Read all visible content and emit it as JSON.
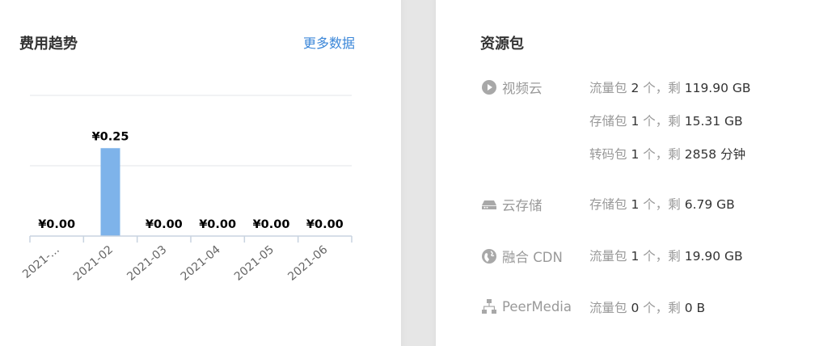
{
  "cost_trend": {
    "title": "费用趋势",
    "more_link": "更多数据"
  },
  "chart_data": {
    "type": "bar",
    "title": "",
    "categories": [
      "2021-...",
      "2021-02",
      "2021-03",
      "2021-04",
      "2021-05",
      "2021-06"
    ],
    "values": [
      0.0,
      0.25,
      0.0,
      0.0,
      0.0,
      0.0
    ],
    "data_labels": [
      "¥0.00",
      "¥0.25",
      "¥0.00",
      "¥0.00",
      "¥0.00",
      "¥0.00"
    ],
    "ylim": [
      0,
      0.4
    ],
    "gridlines": [
      0.2,
      0.4
    ],
    "grid": true,
    "bar_color": "#7eb3ea",
    "xlabel": "",
    "ylabel": ""
  },
  "resources": {
    "title": "资源包",
    "categories": [
      {
        "name": "视频云",
        "icon": "play-circle-icon",
        "lines": [
          {
            "label": "流量包",
            "count": "2",
            "unit": "个，剩",
            "remaining": "119.90 GB"
          },
          {
            "label": "存储包",
            "count": "1",
            "unit": "个，剩",
            "remaining": "15.31 GB"
          },
          {
            "label": "转码包",
            "count": "1",
            "unit": "个，剩",
            "remaining": "2858 分钟"
          }
        ]
      },
      {
        "name": "云存储",
        "icon": "hard-drive-icon",
        "lines": [
          {
            "label": "存储包",
            "count": "1",
            "unit": "个，剩",
            "remaining": "6.79 GB"
          }
        ]
      },
      {
        "name": "融合 CDN",
        "icon": "globe-icon",
        "lines": [
          {
            "label": "流量包",
            "count": "1",
            "unit": "个，剩",
            "remaining": "19.90 GB"
          }
        ]
      },
      {
        "name": "PeerMedia",
        "icon": "network-icon",
        "lines": [
          {
            "label": "流量包",
            "count": "0",
            "unit": "个，剩",
            "remaining": "0 B"
          }
        ]
      }
    ]
  },
  "colors": {
    "accent_link": "#3a86d8",
    "muted_text": "#999999",
    "page_background": "#e6e6e6"
  }
}
